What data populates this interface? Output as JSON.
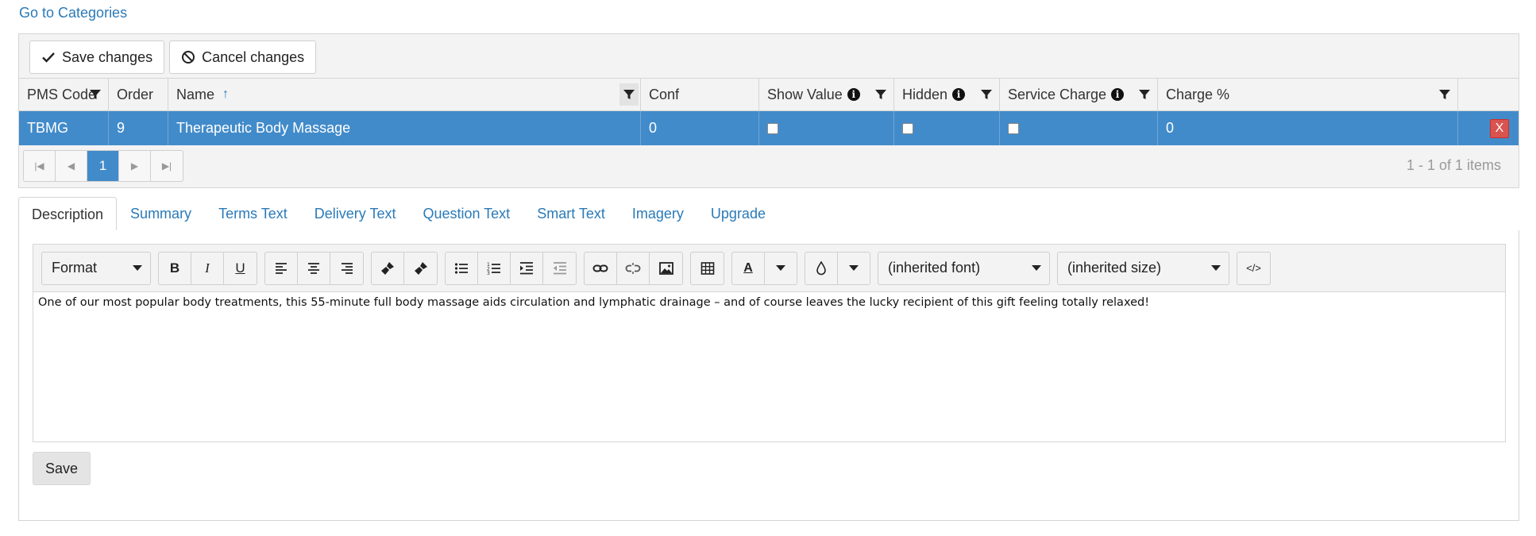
{
  "nav": {
    "goto_categories": "Go to Categories"
  },
  "grid_toolbar": {
    "save_label": "Save changes",
    "cancel_label": "Cancel changes"
  },
  "columns": {
    "pms_code": "PMS Code",
    "order": "Order",
    "name": "Name",
    "conf": "Conf",
    "show_value": "Show Value",
    "hidden": "Hidden",
    "service_charge": "Service Charge",
    "charge_pct": "Charge %"
  },
  "rows": [
    {
      "pms_code": "TBMG",
      "order": "9",
      "name": "Therapeutic Body Massage",
      "conf": "0",
      "show_value": false,
      "hidden": false,
      "service_charge": false,
      "charge_pct": "0",
      "delete_label": "X"
    }
  ],
  "pager": {
    "current_page": "1",
    "info": "1 - 1 of 1 items"
  },
  "tabs": [
    {
      "label": "Description",
      "active": true
    },
    {
      "label": "Summary"
    },
    {
      "label": "Terms Text"
    },
    {
      "label": "Delivery Text"
    },
    {
      "label": "Question Text"
    },
    {
      "label": "Smart Text"
    },
    {
      "label": "Imagery"
    },
    {
      "label": "Upgrade"
    }
  ],
  "editor": {
    "format_label": "Format",
    "font_label": "(inherited font)",
    "size_label": "(inherited size)",
    "bold": "B",
    "italic": "I",
    "underline": "U",
    "font_color_glyph": "A",
    "html_glyph": "</>",
    "content": "One of our most popular body treatments, this 55-minute full body massage aids circulation and lymphatic drainage – and of course leaves the lucky recipient of this gift feeling totally relaxed!",
    "save_label": "Save"
  },
  "colors": {
    "accent": "#428bca",
    "link": "#2a7ab8",
    "danger": "#d9534f"
  }
}
